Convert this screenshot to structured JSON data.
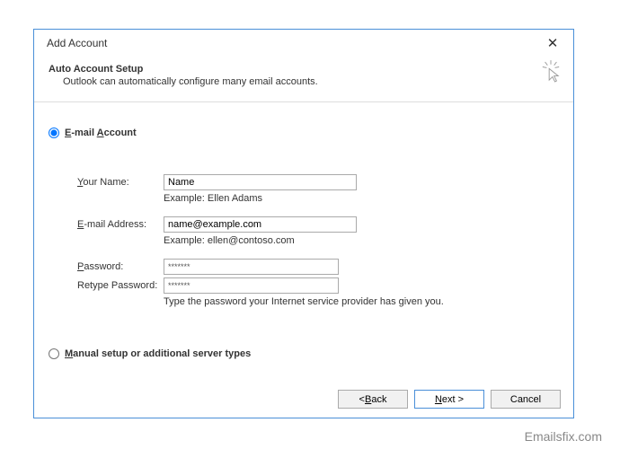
{
  "dialog": {
    "title": "Add Account",
    "close_symbol": "✕"
  },
  "header": {
    "title": "Auto Account Setup",
    "subtitle": "Outlook can automatically configure many email accounts."
  },
  "radio_email": {
    "label_prefix": "E",
    "label_rest": "-mail ",
    "label_u": "A",
    "label_end": "ccount"
  },
  "form": {
    "name_label_u": "Y",
    "name_label_rest": "our Name:",
    "name_value": "Name",
    "name_example": "Example: Ellen Adams",
    "email_label_u": "E",
    "email_label_rest": "-mail Address:",
    "email_value": "name@example.com",
    "email_example": "Example: ellen@contoso.com",
    "password_label_u": "P",
    "password_label_rest": "assword:",
    "password_value": "*******",
    "retype_label": "Retype Password:",
    "retype_value": "*******",
    "password_hint": "Type the password your Internet service provider has given you."
  },
  "radio_manual": {
    "label_u": "M",
    "label_rest": "anual setup or additional server types"
  },
  "buttons": {
    "back_prefix": "< ",
    "back_u": "B",
    "back_rest": "ack",
    "next_u": "N",
    "next_rest": "ext >",
    "cancel": "Cancel"
  },
  "watermark": "Emailsfix.com"
}
